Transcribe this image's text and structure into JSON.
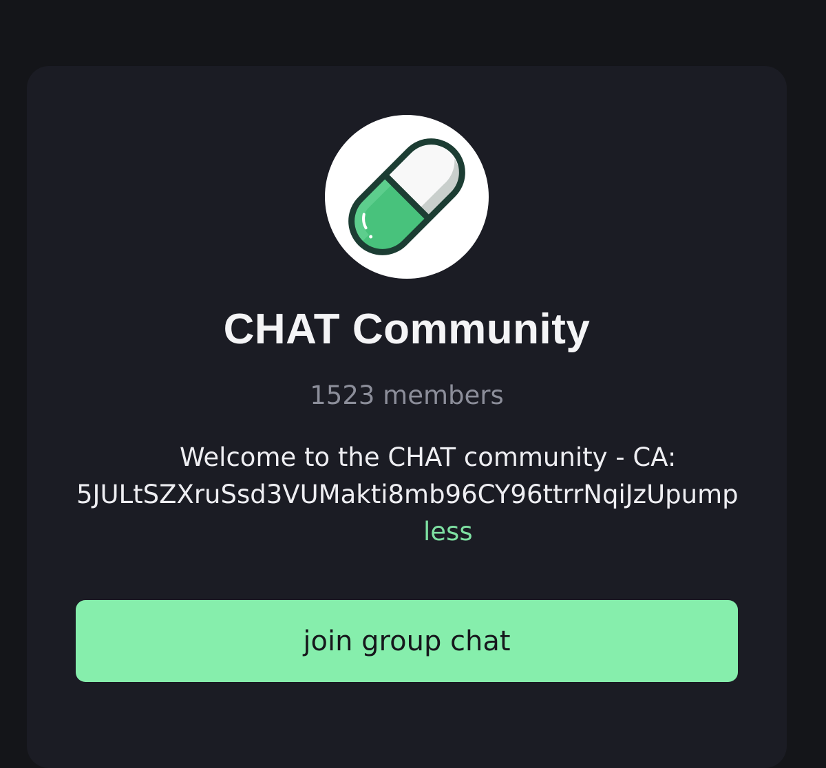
{
  "community": {
    "avatar_icon": "pill-capsule-icon",
    "title": "CHAT Community",
    "members_text": "1523 members"
  },
  "description": {
    "line1": "Welcome to the CHAT community - CA:",
    "line2": "5JULtSZXruSsd3VUMakti8mb96CY96ttrrNqiJzUpump",
    "toggle_label": "less"
  },
  "actions": {
    "join_label": "join group chat"
  },
  "colors": {
    "page_background": "#141519",
    "card_background": "#1b1c24",
    "accent_green": "#86eeac",
    "link_green": "#7ee0a2",
    "muted_text": "#8c8e9a"
  }
}
